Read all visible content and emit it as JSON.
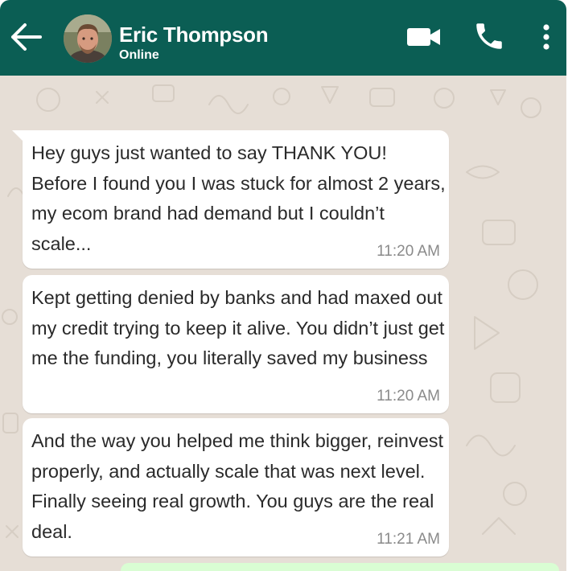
{
  "header": {
    "contact_name": "Eric Thompson",
    "status": "Online",
    "icons": [
      "back-arrow-icon",
      "avatar",
      "video-call-icon",
      "phone-icon",
      "more-options-icon"
    ],
    "color": "#0b5e54"
  },
  "messages": [
    {
      "text": "Hey guys just wanted to say THANK YOU! Before I found you I was stuck for almost 2 years, my ecom brand had demand but I couldn’t scale...",
      "time": "11:20 AM"
    },
    {
      "text": "Kept getting denied by banks and had maxed out my credit trying to keep it alive. You didn’t just get me the funding, you literally saved my business",
      "time": "11:20 AM"
    },
    {
      "text": "And the way you helped me think bigger, reinvest properly, and actually scale that was next level. Finally seeing real growth. You guys are the real deal.",
      "time": "11:21 AM"
    }
  ],
  "colors": {
    "chat_background": "#e6ded6",
    "incoming_bubble": "#ffffff",
    "outgoing_bubble": "#d9fdd3"
  }
}
